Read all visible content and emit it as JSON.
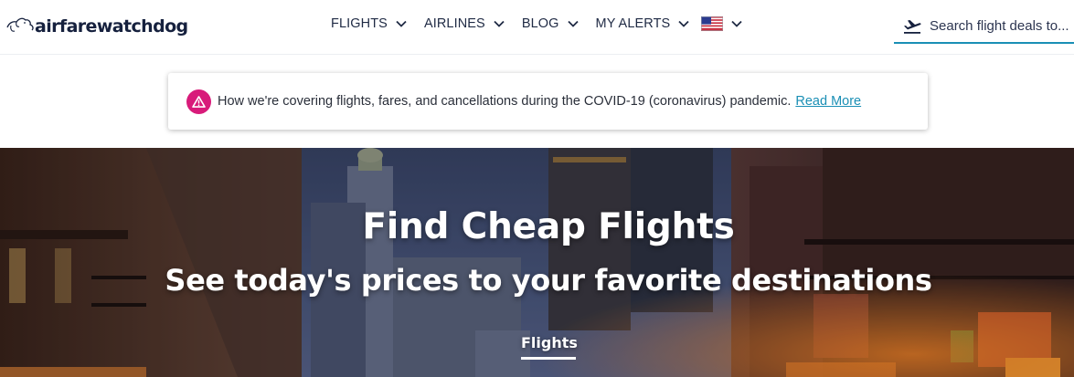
{
  "brand": {
    "logo_text": "airfarewatchdog"
  },
  "nav": {
    "items": [
      {
        "label": "FLIGHTS"
      },
      {
        "label": "AIRLINES"
      },
      {
        "label": "BLOG"
      },
      {
        "label": "MY ALERTS"
      }
    ],
    "region_flag": "us-flag-icon"
  },
  "search": {
    "placeholder": "Search flight deals to..."
  },
  "alert": {
    "icon": "warning-icon",
    "text": "How we're covering flights, fares, and cancellations during the COVID-19 (coronavirus) pandemic.",
    "link_label": "Read More"
  },
  "hero": {
    "title": "Find Cheap Flights",
    "subtitle": "See today's prices to your favorite destinations",
    "active_tab": "Flights"
  },
  "colors": {
    "accent": "#1a8fb5",
    "alert_icon": "#d81b7a",
    "nav_text": "#1f2a44"
  }
}
